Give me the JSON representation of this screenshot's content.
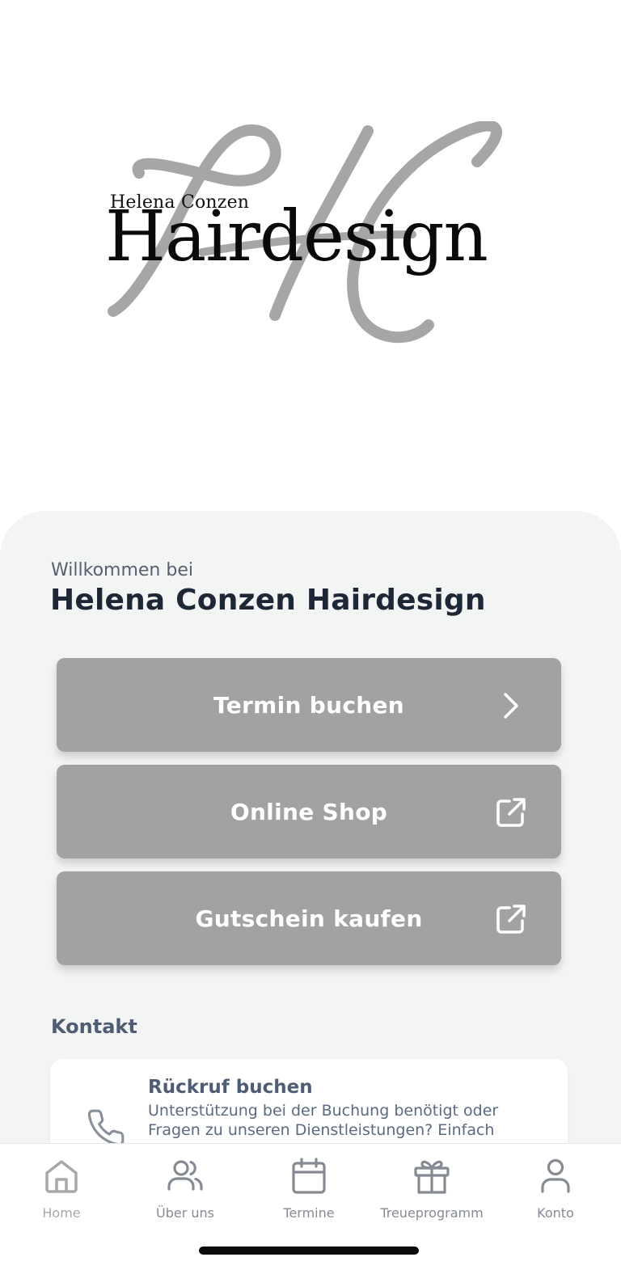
{
  "logo": {
    "subtitle": "Helena Conzen",
    "title": "Hairdesign",
    "icon": "hc-monogram-logo"
  },
  "welcome": {
    "subtitle": "Willkommen bei",
    "title": "Helena Conzen Hairdesign"
  },
  "actions": [
    {
      "label": "Termin buchen",
      "icon": "chevron-right-icon"
    },
    {
      "label": "Online Shop",
      "icon": "external-link-icon"
    },
    {
      "label": "Gutschein kaufen",
      "icon": "external-link-icon"
    }
  ],
  "contact": {
    "section_title": "Kontakt",
    "card_title": "Rückruf buchen",
    "card_text": "Unterstützung bei der Buchung benötigt oder Fragen zu unseren Dienstleistungen? Einfach Kontakt aufnehmen und wir rufen zurück.",
    "icon": "phone-icon"
  },
  "tabs": [
    {
      "label": "Home",
      "icon": "home-icon",
      "active": true
    },
    {
      "label": "Über uns",
      "icon": "users-icon",
      "active": false
    },
    {
      "label": "Termine",
      "icon": "calendar-icon",
      "active": false
    },
    {
      "label": "Treueprogramm",
      "icon": "gift-icon",
      "active": false
    },
    {
      "label": "Konto",
      "icon": "user-icon",
      "active": false
    }
  ],
  "colors": {
    "button": "#a1a2a4",
    "sheet_background": "#f3f5f5",
    "title_text": "#1e2736",
    "muted_text": "#4f5d74",
    "logo_gray": "#a6a6a6"
  }
}
